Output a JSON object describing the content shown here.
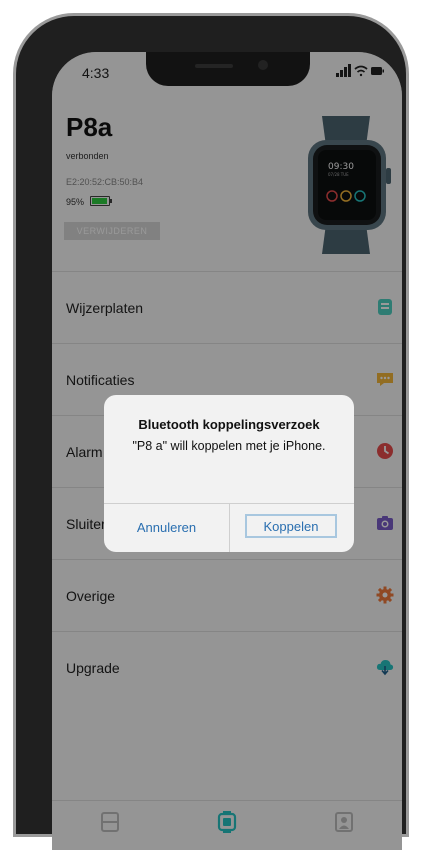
{
  "status_bar": {
    "time": "4:33"
  },
  "device": {
    "name": "P8a",
    "status": "verbonden",
    "mac": "E2:20:52:CB:50:B4",
    "battery": "95%",
    "battery_level": 0.95,
    "remove_label": "VERWIJDEREN"
  },
  "menu": [
    {
      "label": "Wijzerplaten",
      "icon": "watchface-icon",
      "color": "#4ecfc0"
    },
    {
      "label": "Notificaties",
      "icon": "chat-bubble-icon",
      "color": "#f4b63a"
    },
    {
      "label": "Alarm",
      "icon": "clock-icon",
      "color": "#e84c4c"
    },
    {
      "label": "Sluiter",
      "icon": "camera-icon",
      "color": "#7a5cc8"
    },
    {
      "label": "Overige",
      "icon": "gear-icon",
      "color": "#f07a3c"
    },
    {
      "label": "Upgrade",
      "icon": "cloud-download-icon",
      "color": "#27c4c4"
    }
  ],
  "dialog": {
    "title": "Bluetooth koppelingsverzoek",
    "message": "\"P8 a\" will koppelen met je iPhone.",
    "cancel_label": "Annuleren",
    "confirm_label": "Koppelen"
  },
  "tabbar": {
    "active_color": "#27c4c4",
    "inactive_color": "#bdbdbd"
  }
}
